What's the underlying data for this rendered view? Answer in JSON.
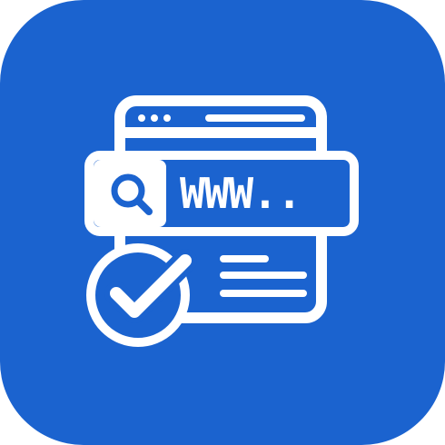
{
  "icon": {
    "name": "website-search-verified-app-icon",
    "url_text": "WWW..",
    "colors": {
      "background": "#1b63cf",
      "foreground": "#ffffff"
    },
    "symbols": [
      "browser-window-icon",
      "search-icon",
      "text-lines-icon",
      "checkmark-circle-icon"
    ]
  }
}
